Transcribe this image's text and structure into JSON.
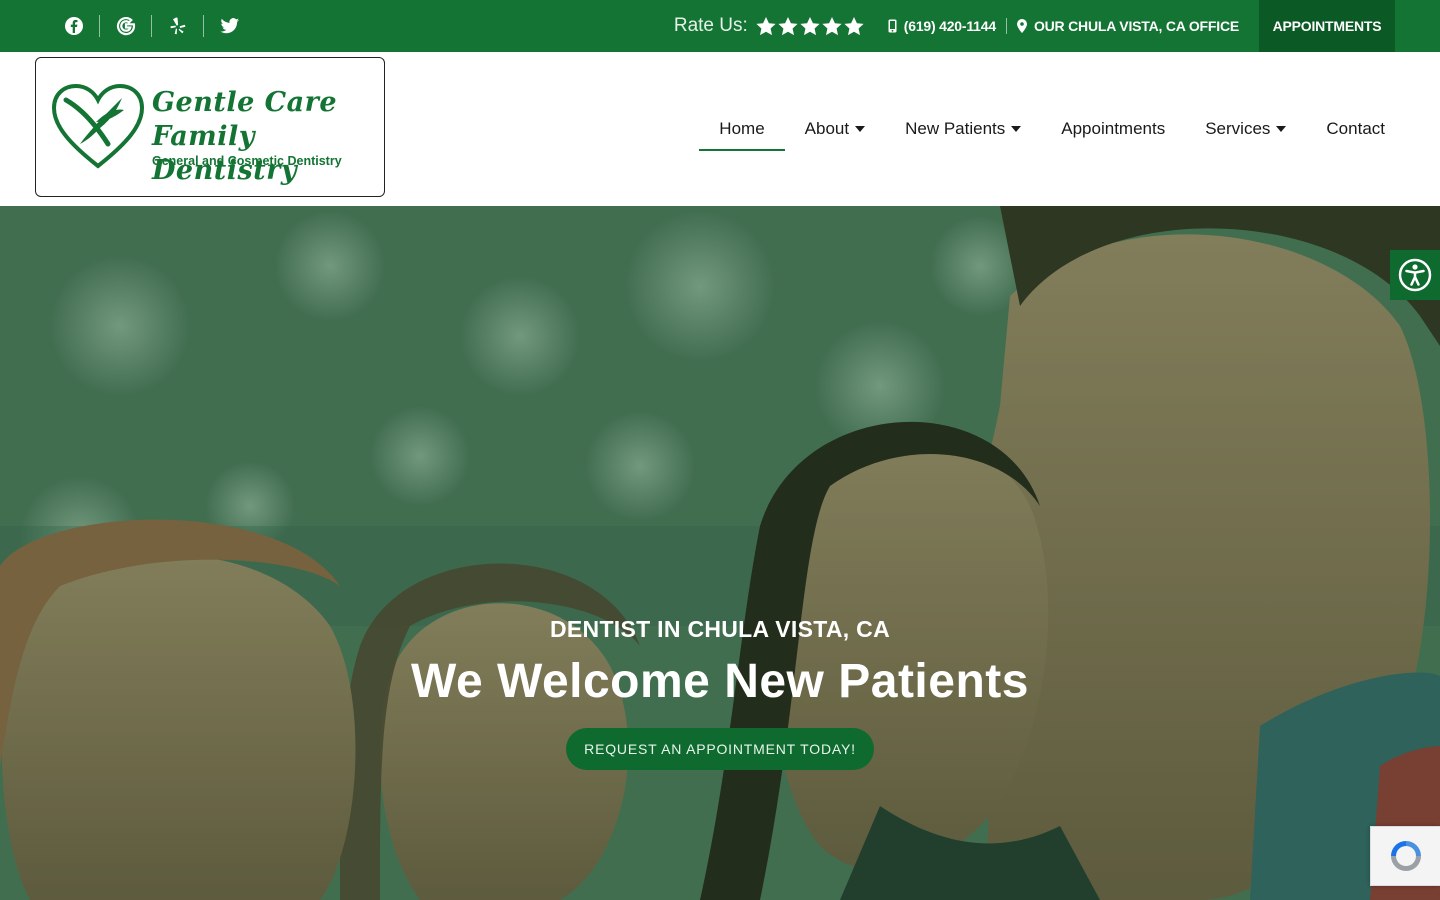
{
  "topbar": {
    "social": [
      {
        "icon": "facebook-icon"
      },
      {
        "icon": "google-icon"
      },
      {
        "icon": "yelp-icon"
      },
      {
        "icon": "twitter-icon"
      }
    ],
    "rate_label": "Rate Us:",
    "rating": {
      "stars": 5,
      "max": 5
    },
    "phone": "(619) 420-1144",
    "office": "OUR CHULA VISTA, CA OFFICE",
    "appointments": "APPOINTMENTS"
  },
  "logo": {
    "line1": "Gentle Care",
    "line2": "Family Dentistry",
    "tagline": "General and Cosmetic Dentistry"
  },
  "nav": {
    "items": [
      {
        "label": "Home",
        "active": true,
        "dropdown": false
      },
      {
        "label": "About",
        "active": false,
        "dropdown": true
      },
      {
        "label": "New Patients",
        "active": false,
        "dropdown": true
      },
      {
        "label": "Appointments",
        "active": false,
        "dropdown": false
      },
      {
        "label": "Services",
        "active": false,
        "dropdown": true
      },
      {
        "label": "Contact",
        "active": false,
        "dropdown": false
      }
    ]
  },
  "hero": {
    "kicker": "DENTIST IN CHULA VISTA, CA",
    "title": "We Welcome New Patients",
    "cta": "REQUEST AN APPOINTMENT TODAY!"
  },
  "colors": {
    "brand": "#137434",
    "brand_dark": "#0b5a25",
    "cta": "#0e6a2f"
  },
  "widgets": {
    "accessibility_icon": "accessibility-icon",
    "recaptcha_icon": "recaptcha-icon"
  }
}
